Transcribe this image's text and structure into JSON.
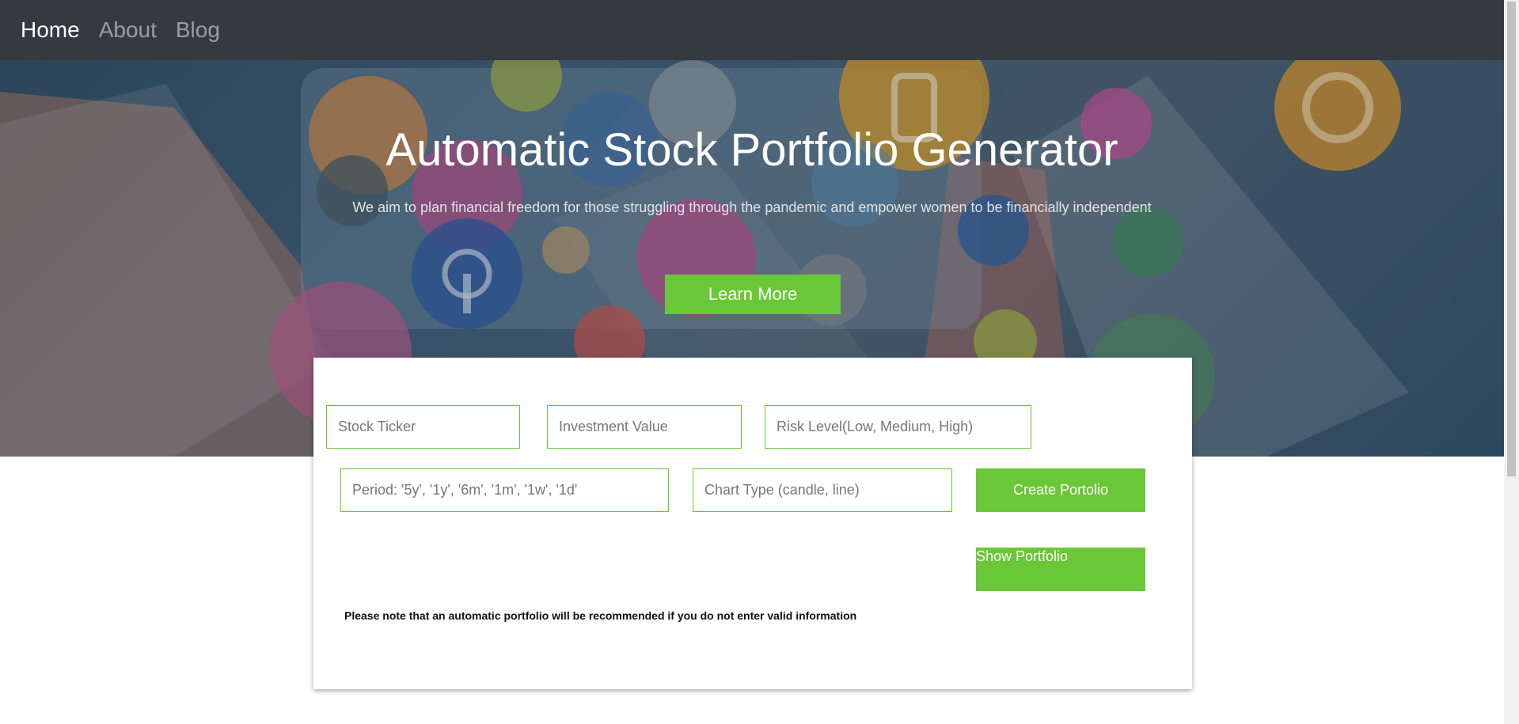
{
  "nav": {
    "items": [
      {
        "label": "Home",
        "active": true
      },
      {
        "label": "About",
        "active": false
      },
      {
        "label": "Blog",
        "active": false
      }
    ]
  },
  "hero": {
    "title": "Automatic Stock Portfolio Generator",
    "subtitle": "We aim to plan financial freedom for those struggling through the pandemic and empower women to be financially independent",
    "learn_more_label": "Learn More"
  },
  "form": {
    "stock_ticker_placeholder": "Stock Ticker",
    "investment_value_placeholder": "Investment Value",
    "risk_level_placeholder": "Risk Level(Low, Medium, High)",
    "period_placeholder": "Period: '5y', '1y', '6m', '1m', '1w', '1d'",
    "chart_type_placeholder": "Chart Type (candle, line)",
    "create_label": "Create Portolio",
    "show_label": "Show Portfolio",
    "note": "Please note that an automatic portfolio will be recommended if you do not enter valid information"
  },
  "colors": {
    "accent": "#6ac737",
    "navbar": "#343a40"
  }
}
